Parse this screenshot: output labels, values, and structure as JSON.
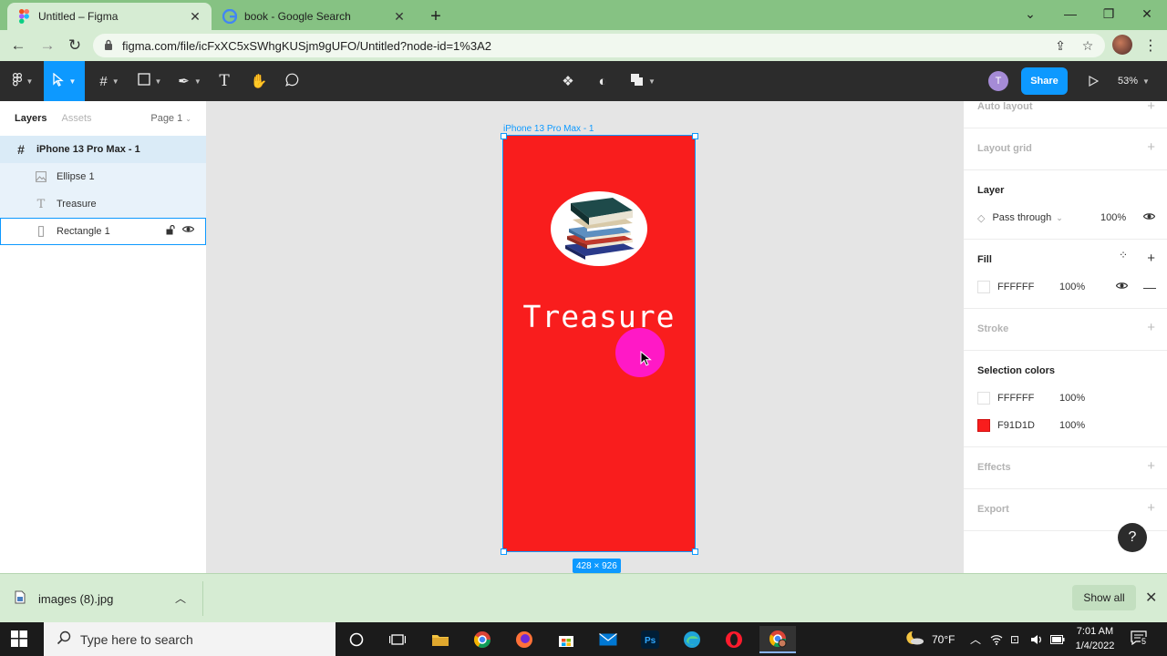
{
  "browser": {
    "tabs": [
      {
        "title": "Untitled – Figma",
        "active": true
      },
      {
        "title": "book - Google Search",
        "active": false
      }
    ],
    "url": "figma.com/file/icFxXC5xSWhgKUSjm9gUFO/Untitled?node-id=1%3A2"
  },
  "figma": {
    "toolbar": {
      "user_initial": "T",
      "share_label": "Share",
      "zoom": "53%"
    },
    "left_panel": {
      "tabs": [
        "Layers",
        "Assets"
      ],
      "page": "Page 1",
      "layers": [
        {
          "name": "iPhone 13 Pro Max - 1",
          "icon": "frame-icon"
        },
        {
          "name": "Ellipse 1",
          "icon": "image-icon"
        },
        {
          "name": "Treasure",
          "icon": "text-icon"
        },
        {
          "name": "Rectangle 1",
          "icon": "rectangle-icon"
        }
      ]
    },
    "canvas": {
      "frame_label": "iPhone 13 Pro Max - 1",
      "frame_color": "#f91d1d",
      "text": "Treasure",
      "dimensions": "428 × 926"
    },
    "right_panel": {
      "auto_layout": "Auto layout",
      "layout_grid": "Layout grid",
      "layer": {
        "title": "Layer",
        "blend": "Pass through",
        "opacity": "100%"
      },
      "fill": {
        "title": "Fill",
        "hex": "FFFFFF",
        "opacity": "100%"
      },
      "stroke": "Stroke",
      "selection_colors": {
        "title": "Selection colors",
        "colors": [
          {
            "hex": "FFFFFF",
            "opacity": "100%",
            "swatch": "#ffffff"
          },
          {
            "hex": "F91D1D",
            "opacity": "100%",
            "swatch": "#f91d1d"
          }
        ]
      },
      "effects": "Effects",
      "export": "Export",
      "help": "?"
    }
  },
  "downloads": {
    "file": "images (8).jpg",
    "show_all": "Show all"
  },
  "taskbar": {
    "search_placeholder": "Type here to search",
    "temperature": "70°F",
    "time": "7:01 AM",
    "date": "1/4/2022",
    "notifications": "5"
  }
}
